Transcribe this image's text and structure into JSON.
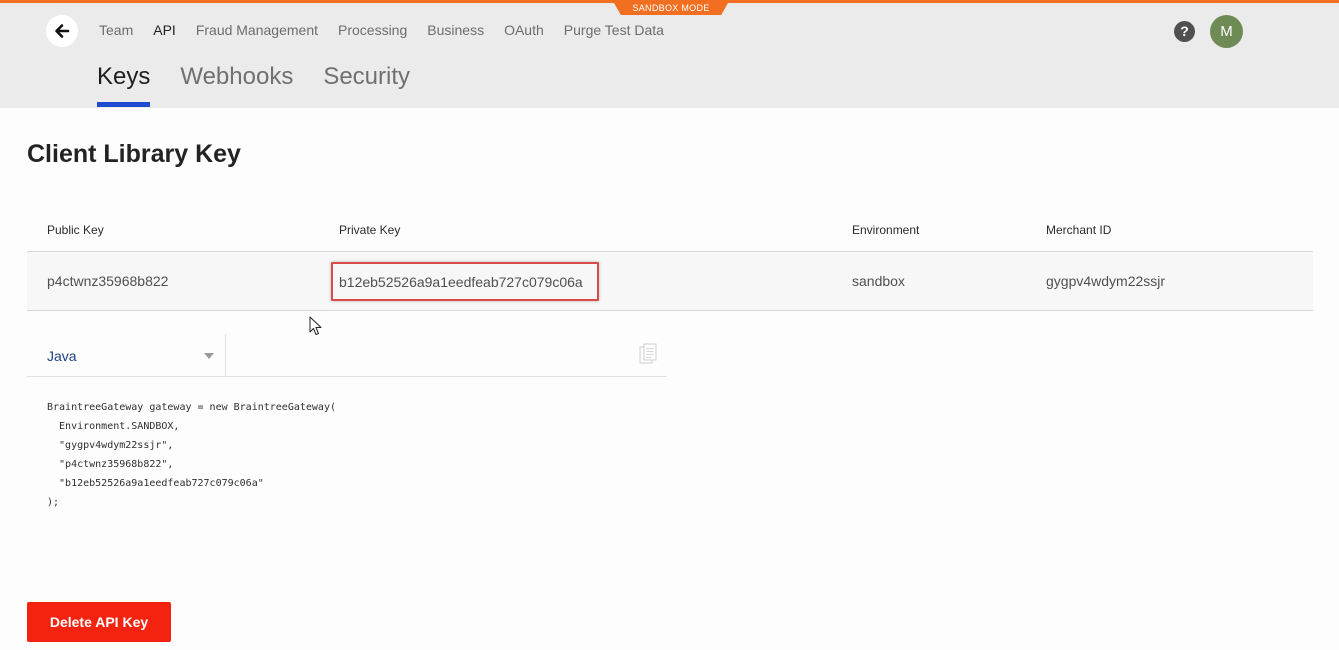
{
  "sandbox_badge": "SANDBOX MODE",
  "top_nav": [
    "Team",
    "API",
    "Fraud Management",
    "Processing",
    "Business",
    "OAuth",
    "Purge Test Data"
  ],
  "top_nav_active": "API",
  "help_label": "?",
  "avatar_initial": "M",
  "sub_tabs": [
    "Keys",
    "Webhooks",
    "Security"
  ],
  "sub_tab_active": "Keys",
  "page_title": "Client Library Key",
  "table": {
    "headers": [
      "Public Key",
      "Private Key",
      "Environment",
      "Merchant ID"
    ],
    "row": {
      "public_key": "p4ctwnz35968b822",
      "private_key": "b12eb52526a9a1eedfeab727c079c06a",
      "environment": "sandbox",
      "merchant_id": "gygpv4wdym22ssjr"
    }
  },
  "code": {
    "language": "Java",
    "snippet": "BraintreeGateway gateway = new BraintreeGateway(\n  Environment.SANDBOX,\n  \"gygpv4wdym22ssjr\",\n  \"p4ctwnz35968b822\",\n  \"b12eb52526a9a1eedfeab727c079c06a\"\n);"
  },
  "delete_button": "Delete API Key",
  "colors": {
    "accent_orange": "#f26f21",
    "tab_underline": "#1f4bd3",
    "delete_red": "#f3230f",
    "highlight_red": "#d94a4a"
  },
  "icons": {
    "back": "arrow-left-icon",
    "copy": "copy-icon",
    "dropdown": "chevron-down-icon",
    "cursor": "mouse-cursor-icon"
  }
}
